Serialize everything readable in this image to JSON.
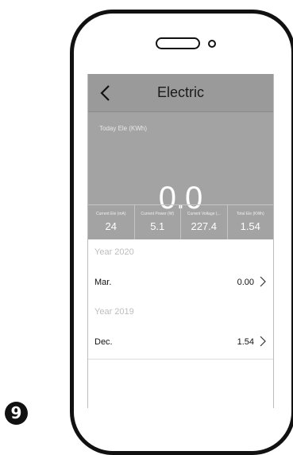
{
  "header": {
    "title": "Electric"
  },
  "today": {
    "label": "Today Ele (KWh)",
    "value": "0.0"
  },
  "stats": [
    {
      "label": "Current Ele (mA)",
      "value": "24"
    },
    {
      "label": "Current Power (W)",
      "value": "5.1"
    },
    {
      "label": "Current Voltage (...",
      "value": "227.4"
    },
    {
      "label": "Total Ele (KWh)",
      "value": "1.54"
    }
  ],
  "years": [
    {
      "year": "Year 2020",
      "months": [
        {
          "month": "Mar.",
          "value": "0.00"
        }
      ]
    },
    {
      "year": "Year 2019",
      "months": [
        {
          "month": "Dec.",
          "value": "1.54"
        }
      ]
    }
  ],
  "step": {
    "number": "9"
  },
  "icons": {
    "back": "chevron-left-icon",
    "row": "chevron-right-icon"
  },
  "colors": {
    "header_bg": "#9a9a9a",
    "hero_bg": "#a3a3a3",
    "frame": "#111111"
  }
}
